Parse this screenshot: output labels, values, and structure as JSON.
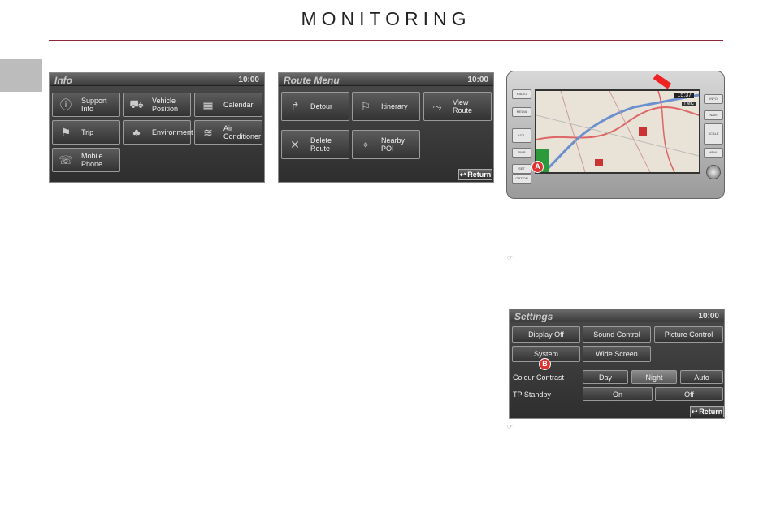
{
  "header": {
    "title": "MONITORING"
  },
  "info_screen": {
    "title": "Info",
    "time": "10:00",
    "buttons": [
      {
        "label": "Support Info",
        "icon": "info-icon"
      },
      {
        "label": "Vehicle Position",
        "icon": "car-position-icon"
      },
      {
        "label": "Calendar",
        "icon": "calendar-icon"
      },
      {
        "label": "Trip",
        "icon": "trip-icon"
      },
      {
        "label": "Environment",
        "icon": "environment-icon"
      },
      {
        "label": "Air Conditioner",
        "icon": "air-conditioner-icon"
      },
      {
        "label": "Mobile Phone",
        "icon": "mobile-phone-icon"
      }
    ]
  },
  "route_screen": {
    "title": "Route Menu",
    "time": "10:00",
    "buttons": [
      {
        "label": "Detour",
        "icon": "detour-icon"
      },
      {
        "label": "Itinerary",
        "icon": "itinerary-icon"
      },
      {
        "label": "View Route",
        "icon": "view-route-icon"
      },
      {
        "label": "Delete Route",
        "icon": "delete-route-icon"
      },
      {
        "label": "Nearby POI",
        "icon": "nearby-poi-icon"
      }
    ],
    "return_label": "Return"
  },
  "device": {
    "clock": "15:37",
    "tmc": "TMC",
    "marker_a": "A",
    "left_keys": [
      "RADIO",
      "MEDIA",
      "VOL",
      "PWR",
      "SET",
      "OPTION"
    ],
    "right_keys": [
      "INFO",
      "NAVI",
      "SCALE",
      "MENU"
    ]
  },
  "settings_screen": {
    "title": "Settings",
    "time": "10:00",
    "buttons": {
      "display_off": "Display Off",
      "sound_control": "Sound Control",
      "picture_control": "Picture Control",
      "system": "System",
      "wide_screen": "Wide Screen"
    },
    "marker_b": "B",
    "colour_contrast": {
      "label": "Colour Contrast",
      "options": [
        "Day",
        "Night",
        "Auto"
      ]
    },
    "tp_standby": {
      "label": "TP Standby",
      "options": [
        "On",
        "Off"
      ]
    },
    "return_label": "Return"
  },
  "notes": {
    "symbol": "☞"
  }
}
